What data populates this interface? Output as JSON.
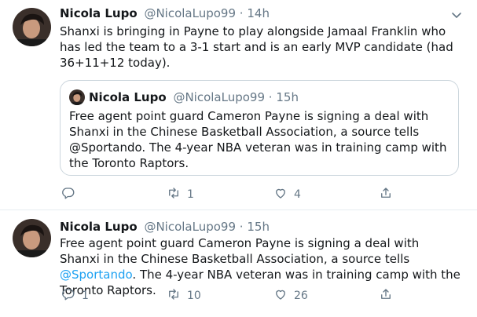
{
  "colors": {
    "link": "#1da1f2",
    "muted": "#657786",
    "text": "#14171a",
    "border": "#e6ecf0"
  },
  "tweets": [
    {
      "author_name": "Nicola Lupo",
      "author_handle": "@NicolaLupo99",
      "separator": "·",
      "time": "14h",
      "text": "Shanxi is bringing in Payne to play alongside Jamaal Franklin who has led the team to a 3-1 start and is an early MVP candidate (had 36+11+12 today).",
      "quoted": {
        "author_name": "Nicola Lupo",
        "author_handle": "@NicolaLupo99",
        "separator": "·",
        "time": "15h",
        "text": "Free agent point guard Cameron Payne is signing a deal with Shanxi in the Chinese Basketball Association, a source tells @Sportando. The 4-year NBA veteran was in training camp with the Toronto Raptors."
      },
      "actions": {
        "replies": "",
        "retweets": "1",
        "likes": "4"
      },
      "icons": [
        "reply-icon",
        "retweet-icon",
        "like-icon",
        "share-icon",
        "chevron-down-icon"
      ]
    },
    {
      "author_name": "Nicola Lupo",
      "author_handle": "@NicolaLupo99",
      "separator": "·",
      "time": "15h",
      "text_before": "Free agent point guard Cameron Payne is signing a deal with Shanxi in the Chinese Basketball Association, a source tells ",
      "mention": "@Sportando",
      "text_after": ". The 4-year NBA veteran was in training camp with the Toronto Raptors.",
      "actions": {
        "replies": "1",
        "retweets": "10",
        "likes": "26"
      },
      "icons": [
        "reply-icon",
        "retweet-icon",
        "like-icon",
        "share-icon"
      ]
    }
  ]
}
